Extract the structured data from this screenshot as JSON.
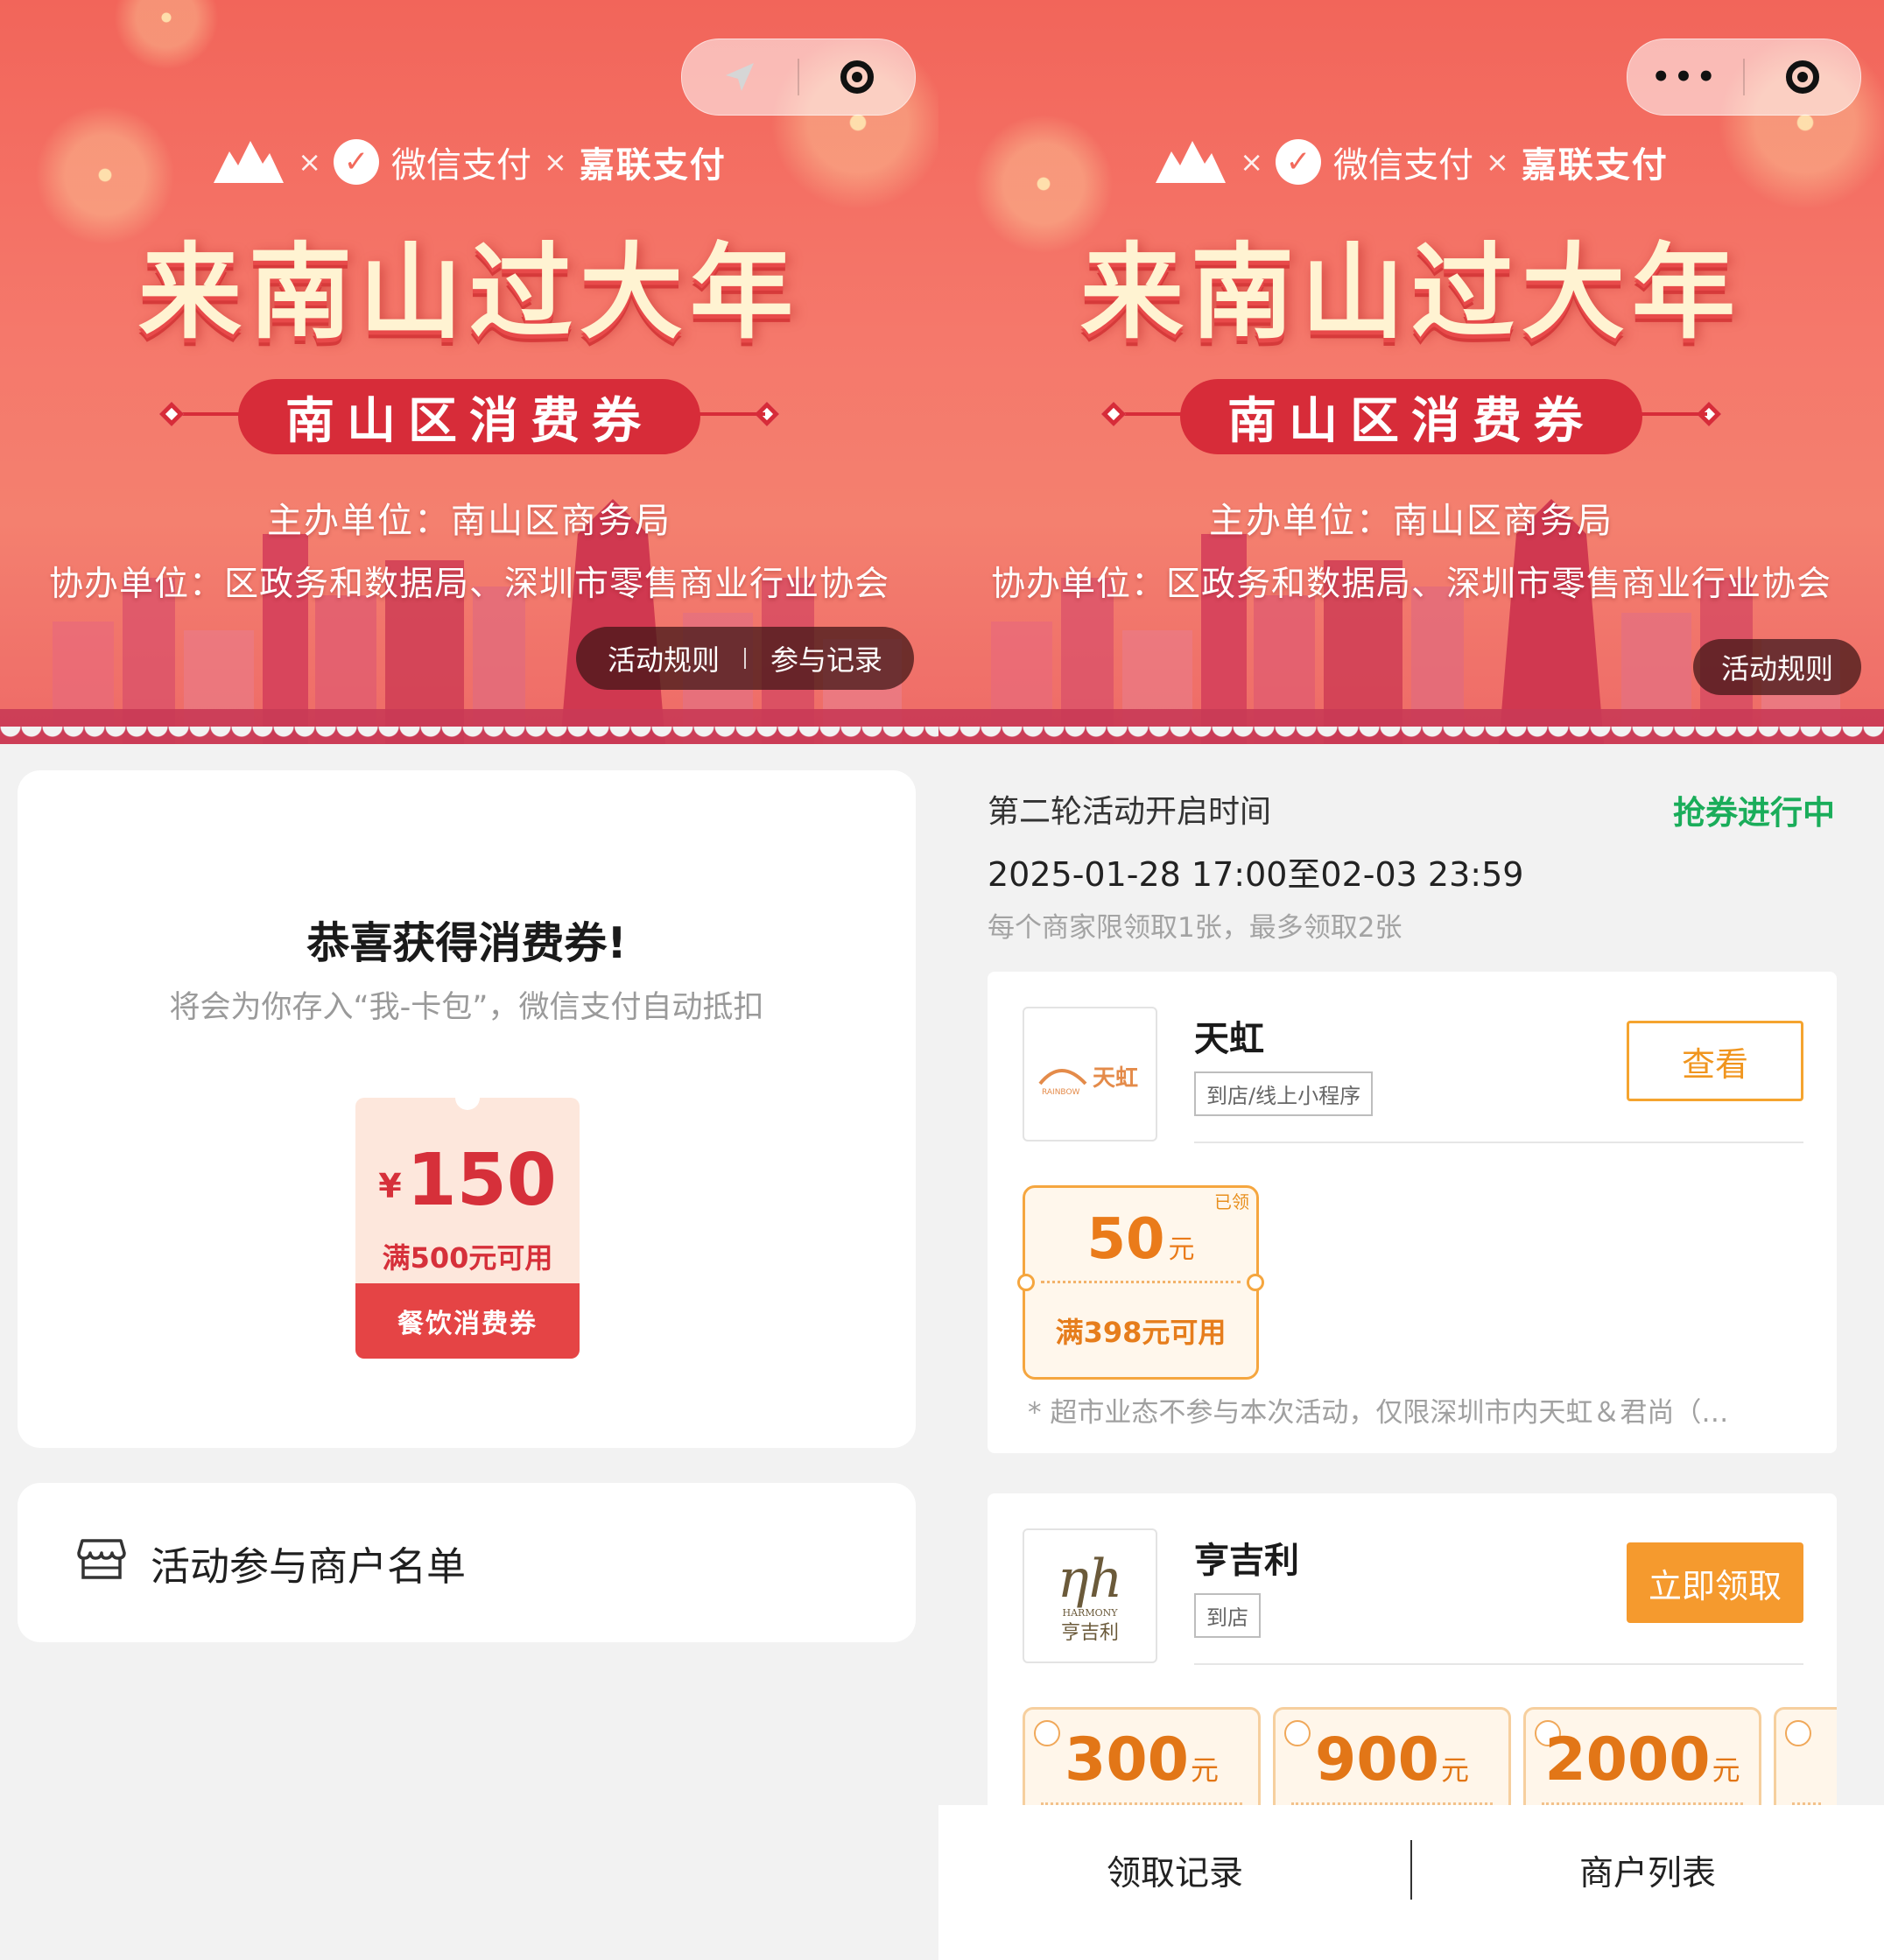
{
  "colors": {
    "banner_red": "#f2655a",
    "coupon_red": "#e54445",
    "orange": "#f59a2e",
    "green_status": "#1aad5a"
  },
  "left": {
    "capsule": {
      "left_icon": "location-arrow-icon",
      "right_icon": "close-target-icon"
    },
    "banner": {
      "sponsors": [
        "微信支付",
        "嘉联支付"
      ],
      "times_sign": "×",
      "title": "来南山过大年",
      "ribbon": "南山区消费券",
      "organizer": "主办单位：南山区商务局",
      "co_organizer": "协办单位：区政务和数据局、深圳市零售商业行业协会",
      "rules_link": "活动规则",
      "records_link": "参与记录"
    },
    "win_card": {
      "title": "恭喜获得消费券!",
      "subtitle": "将会为你存入“我-卡包”，微信支付自动抵扣",
      "coupon": {
        "currency": "¥",
        "amount": "150",
        "condition": "满500元可用",
        "type": "餐饮消费券"
      }
    },
    "merchant_list": {
      "label": "活动参与商户名单",
      "icon": "store-icon"
    }
  },
  "right": {
    "capsule": {
      "left_icon": "more-dots-icon",
      "right_icon": "close-target-icon",
      "more_text": "•••"
    },
    "banner": {
      "sponsors": [
        "微信支付",
        "嘉联支付"
      ],
      "times_sign": "×",
      "title": "来南山过大年",
      "ribbon": "南山区消费券",
      "organizer": "主办单位：南山区商务局",
      "co_organizer": "协办单位：区政务和数据局、深圳市零售商业行业协会",
      "rules_link": "活动规则"
    },
    "round": {
      "title": "第二轮活动开启时间",
      "status": "抢券进行中",
      "time": "2025-01-28 17:00至02-03 23:59",
      "limit": "每个商家限领取1张，最多领取2张"
    },
    "shops": [
      {
        "name": "天虹",
        "logo_text": "天虹",
        "logo_sub": "RAINBOW",
        "tag": "到店/线上小程序",
        "button": "查看",
        "coupons": [
          {
            "value": "50",
            "unit": "元",
            "condition": "满398元可用",
            "badge": "已领"
          }
        ],
        "note": "* 超市业态不参与本次活动，仅限深圳市内天虹＆君尚（…"
      },
      {
        "name": "亨吉利",
        "logo_text": "亨吉利",
        "logo_sub": "HARMONY",
        "tag": "到店",
        "button": "立即领取",
        "coupons": [
          {
            "value": "300",
            "unit": "元"
          },
          {
            "value": "900",
            "unit": "元"
          },
          {
            "value": "2000",
            "unit": "元"
          }
        ]
      }
    ],
    "bottom_tabs": [
      "领取记录",
      "商户列表"
    ]
  }
}
